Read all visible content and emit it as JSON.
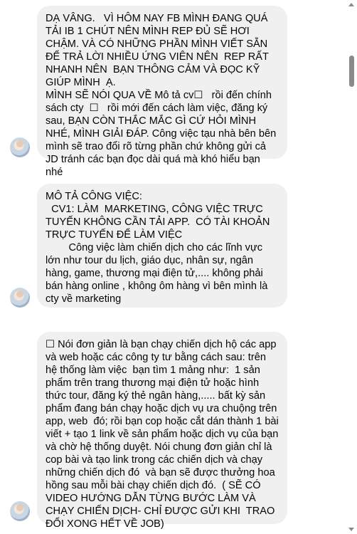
{
  "messages": [
    {
      "sender": "received",
      "text": "DẠ VÂNG.   VÌ HÔM NAY FB MÌNH ĐANG QUÁ TẢI IB 1 CHÚT NÊN MÌNH REP ĐỦ SẼ HƠI CHẬM. VÀ CÓ NHỮNG PHẦN MÌNH VIẾT SẴN ĐỂ TRẢ LỜI NHIỀU ỨNG VIÊN NÊN  REP RẤT NHANH NÊN  BẠN THÔNG CẢM VÀ ĐỌC KỸ GIÚP MÌNH  Ạ.\nMÌNH SẼ NÓI QUA VỀ Mô tả cv☐   rồi đến chính sách cty  ☐   rồi mới đến cách làm việc, đăng ký sau, BẠN CÒN THẮC MẮC GÌ CỨ HỎI MÌNH NHÉ, MÌNH GIẢI ĐÁP. Công việc tạu nhà bên bên mình sẽ trao đổi rõ từng phần chứ không gửi cả JD tránh các bạn đọc dài quá mà khó hiểu bạn nhé"
    },
    {
      "sender": "received",
      "text": "MÔ TẢ CÔNG VIỆC:\n  CV1: LÀM  MARKETING, CÔNG VIỆC TRỰC TUYẾN KHÔNG CẦN TẢI APP.  CÓ TÀI KHOẢN TRỰC TUYẾN ĐỂ LÀM VIỆC\n        Công việc làm chiến dịch cho các lĩnh vực lớn như tour du lịch, giáo dục, nhân sự, ngân hàng, game, thương mại điện tử,.... không phải bán hàng online , không ôm hàng vì bên mình là cty về marketing"
    },
    {
      "sender": "received",
      "text": "☐ Nói đơn giản là bạn chạy chiến dịch hộ các app và web hoặc các công ty tư bằng cách sau: trên hệ thống làm việc  bạn tìm 1 mảng như:  1 sản phẩm trên trang thương mại điện tử hoặc hình thức tour, đăng ký thẻ ngân hàng,..... bất kỳ sản phẩm đang bán chạy hoặc dịch vụ ưa chuộng trên app, web  đó; rồi bạn cop hoặc cắt dán thành 1 bài viết + tạo 1 link về sản phẩm hoặc dịch vụ của bạn và chờ hệ thống duyệt. Nói chung đơn giản chỉ là cop bài và tạo link trong các chiến dịch và chạy những chiến dịch đó  và bạn sẽ được thưởng hoa hồng sau mỗi bài chạy chiến dịch đó.  ( SẼ CÓ VIDEO HƯỚNG DẪN TỪNG BƯỚC LÀM VÀ CHẠY CHIẾN DỊCH- CHỈ ĐƯỢC GỬI KHI  TRAO ĐỔI XONG HẾT VỀ JOB)"
    }
  ]
}
